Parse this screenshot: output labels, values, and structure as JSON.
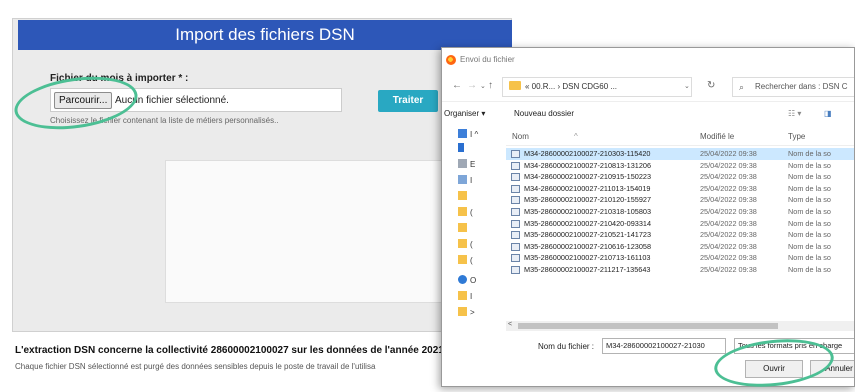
{
  "app": {
    "title": "Import des fichiers DSN",
    "field_label": "Fichier du mois à importer * :",
    "browse_label": "Parcourir...",
    "file_status": "Aucun fichier sélectionné.",
    "help_text": "Choisissez le fichier contenant la liste de métiers personnalisés..",
    "submit_label": "Traiter",
    "extraction_note": "L'extraction DSN concerne la collectivité 28600002100027 sur les données de l'année 2021",
    "purge_note": "Chaque fichier DSN sélectionné est purgé des données sensibles depuis le poste de travail de l'utilisa"
  },
  "dialog": {
    "title": "Envoi du fichier",
    "breadcrumb": "« 00.R... › DSN CDG60 ...",
    "search_placeholder": "Rechercher dans : DSN C",
    "organize_label": "Organiser ▾",
    "new_folder_label": "Nouveau dossier",
    "columns": {
      "name": "Nom",
      "modified": "Modifié le",
      "type": "Type"
    },
    "files": [
      {
        "name": "M34-28600002100027-210303-115420",
        "date": "25/04/2022 09:38",
        "type": "Nom de la so"
      },
      {
        "name": "M34-28600002100027-210813-131206",
        "date": "25/04/2022 09:38",
        "type": "Nom de la so"
      },
      {
        "name": "M34-28600002100027-210915-150223",
        "date": "25/04/2022 09:38",
        "type": "Nom de la so"
      },
      {
        "name": "M34-28600002100027-211013-154019",
        "date": "25/04/2022 09:38",
        "type": "Nom de la so"
      },
      {
        "name": "M35-28600002100027-210120-155927",
        "date": "25/04/2022 09:38",
        "type": "Nom de la so"
      },
      {
        "name": "M35-28600002100027-210318-105803",
        "date": "25/04/2022 09:38",
        "type": "Nom de la so"
      },
      {
        "name": "M35-28600002100027-210420-093314",
        "date": "25/04/2022 09:38",
        "type": "Nom de la so"
      },
      {
        "name": "M35-28600002100027-210521-141723",
        "date": "25/04/2022 09:38",
        "type": "Nom de la so"
      },
      {
        "name": "M35-28600002100027-210616-123058",
        "date": "25/04/2022 09:38",
        "type": "Nom de la so"
      },
      {
        "name": "M35-28600002100027-210713-161103",
        "date": "25/04/2022 09:38",
        "type": "Nom de la so"
      },
      {
        "name": "M35-28600002100027-211217-135643",
        "date": "25/04/2022 09:38",
        "type": "Nom de la so"
      }
    ],
    "filename_label": "Nom du fichier :",
    "filename_value": "M34-28600002100027-21030",
    "filetype_value": "Tous les formats pris en charge",
    "open_label": "Ouvrir",
    "cancel_label": "Annuler"
  },
  "colors": {
    "header": "#2d57b8",
    "submit": "#29a8c2",
    "highlight": "#4cbf94",
    "selected_row": "#cce8ff"
  }
}
